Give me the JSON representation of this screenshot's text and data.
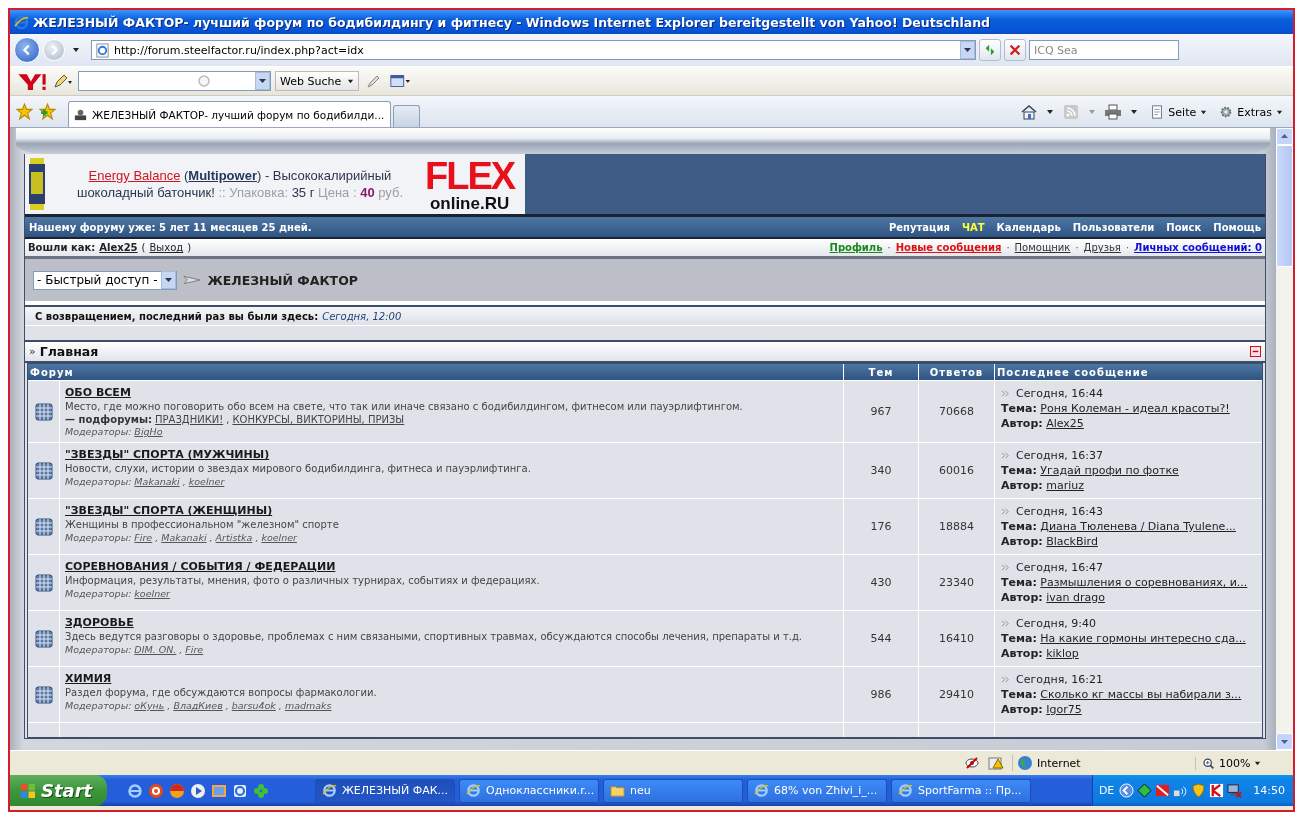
{
  "window": {
    "title": "ЖЕЛЕЗНЫЙ ФАКТОР- лучший форум по бодибилдингу и фитнесу - Windows Internet Explorer bereitgestellt von Yahoo! Deutschland"
  },
  "address_bar": {
    "url": "http://forum.steelfactor.ru/index.php?act=idx"
  },
  "search_field": {
    "placeholder": "ICQ Sea"
  },
  "yahoo_toolbar": {
    "search_button": "Web Suche"
  },
  "tabs": [
    {
      "label": "ЖЕЛЕЗНЫЙ ФАКТОР- лучший форум по бодибилди...",
      "selected": true
    }
  ],
  "command_bar": [
    "Seite",
    "Extras"
  ],
  "banner": {
    "parts": [
      {
        "kind": "product",
        "text": "Energy Balance"
      },
      {
        "kind": "text",
        "text": " ("
      },
      {
        "kind": "brand",
        "text": "Multipower"
      },
      {
        "kind": "text",
        "text": ") - Высококалирийный шоколадный батончик!"
      },
      {
        "kind": "muted",
        "text": " :: Упаковка: "
      },
      {
        "kind": "text",
        "text": "35 г"
      },
      {
        "kind": "muted",
        "text": " Цена : "
      },
      {
        "kind": "price",
        "text": "40"
      },
      {
        "kind": "muted",
        "text": " руб."
      }
    ],
    "logo_top": "FLEX",
    "logo_bottom": "online.RU"
  },
  "forum_age": "Нашему форуму уже: 5 лет 11 месяцев 25 дней.",
  "nav_links": [
    {
      "label": "Репутация",
      "highlighted": false
    },
    {
      "label": "ЧАТ",
      "highlighted": true
    },
    {
      "label": "Календарь",
      "highlighted": false
    },
    {
      "label": "Пользователи",
      "highlighted": false
    },
    {
      "label": "Поиск",
      "highlighted": false
    },
    {
      "label": "Помощь",
      "highlighted": false
    }
  ],
  "login": {
    "label": "Вошли как:",
    "user": "Alex25",
    "open": "(",
    "logout": "Выход",
    "close": ")"
  },
  "user_links": [
    {
      "label": "Профиль",
      "kind": "profile"
    },
    {
      "label": "Новые сообщения",
      "kind": "new"
    },
    {
      "label": "Помощник",
      "kind": "plain"
    },
    {
      "label": "Друзья",
      "kind": "plain"
    },
    {
      "label": "Личных сообщений: 0",
      "kind": "messages"
    }
  ],
  "separator": "·",
  "quick_access": {
    "value": "- Быстрый доступ -"
  },
  "forum_name": "ЖЕЛЕЗНЫЙ ФАКТОР",
  "welcome": {
    "text": "С возвращением, последний раз вы были здесь:",
    "time": "Сегодня, 12:00"
  },
  "category": {
    "marker": "»",
    "title": "Главная"
  },
  "table": {
    "columns": [
      "Форум",
      "Тем",
      "Ответов",
      "Последнее сообщение"
    ],
    "list_separator": ",",
    "rows": [
      {
        "name": "ОБО ВСЕМ",
        "description": "Место, где можно поговорить обо всем на свете, что так или иначе связано с бодибилдингом, фитнесом или пауэрлифтингом.",
        "subforums_label": "— подфорумы:",
        "subforums": [
          "ПРАЗДНИКИ!",
          "КОНКУРСЫ, ВИКТОРИНЫ, ПРИЗЫ"
        ],
        "moderators_label": "Модераторы:",
        "moderators": [
          "BigHo"
        ],
        "topics": "967",
        "replies": "70668",
        "last": {
          "time": "Сегодня, 16:44",
          "topic_label": "Тема:",
          "topic": "Роня Колеман - идеал красоты?!",
          "author_label": "Автор:",
          "author": "Alex25"
        }
      },
      {
        "name": "\"ЗВЕЗДЫ\" СПОРТА (МУЖЧИНЫ)",
        "description": "Новости, слухи, истории о звездах мирового бодибилдинга, фитнеса и пауэрлифтинга.",
        "moderators_label": "Модераторы:",
        "moderators": [
          "Makanaki",
          "koelner"
        ],
        "topics": "340",
        "replies": "60016",
        "last": {
          "time": "Сегодня, 16:37",
          "topic_label": "Тема:",
          "topic": "Угадай профи по фотке",
          "author_label": "Автор:",
          "author": "mariuz"
        }
      },
      {
        "name": "\"ЗВЕЗДЫ\" СПОРТА (ЖЕНЩИНЫ)",
        "description": "Женщины в профессиональном \"железном\" спорте",
        "moderators_label": "Модераторы:",
        "moderators": [
          "Fire",
          "Makanaki",
          "Artistka",
          "koelner"
        ],
        "topics": "176",
        "replies": "18884",
        "last": {
          "time": "Сегодня, 16:43",
          "topic_label": "Тема:",
          "topic": "Диана Тюленева / Diana Tyulene...",
          "author_label": "Автор:",
          "author": "BlackBird"
        }
      },
      {
        "name": "СОРЕВНОВАНИЯ / СОБЫТИЯ / ФЕДЕРАЦИИ",
        "description": "Информация, результаты, мнения, фото о различных турнирах, событиях и федерациях.",
        "moderators_label": "Модераторы:",
        "moderators": [
          "koelner"
        ],
        "topics": "430",
        "replies": "23340",
        "last": {
          "time": "Сегодня, 16:47",
          "topic_label": "Тема:",
          "topic": "Размышления о соревнованиях, и...",
          "author_label": "Автор:",
          "author": "ivan drago"
        }
      },
      {
        "name": "ЗДОРОВЬЕ",
        "description": "Здесь ведутся разговоры о здоровье, проблемах с ним связаными, спортивных травмах, обсуждаются способы лечения, препараты и т.д.",
        "moderators_label": "Модераторы:",
        "moderators": [
          "DIM. ON.",
          "Fire"
        ],
        "topics": "544",
        "replies": "16410",
        "last": {
          "time": "Сегодня, 9:40",
          "topic_label": "Тема:",
          "topic": "На какие гормоны интересно сда...",
          "author_label": "Автор:",
          "author": "kiklop"
        }
      },
      {
        "name": "ХИМИЯ",
        "description": "Раздел форума, где обсуждаются вопросы фармакологии.",
        "moderators_label": "Модераторы:",
        "moderators": [
          "oКунь",
          "ВладКиев",
          "barsu4ok",
          "madmaks"
        ],
        "topics": "986",
        "replies": "29410",
        "last": {
          "time": "Сегодня, 16:21",
          "topic_label": "Тема:",
          "topic": "Сколько кг массы вы набирали з...",
          "author_label": "Автор:",
          "author": "Igor75"
        }
      }
    ]
  },
  "status_bar": {
    "zone": "Internet",
    "zoom": "100%"
  },
  "taskbar": {
    "start": "Start",
    "windows": [
      {
        "label": "ЖЕЛЕЗНЫЙ ФАК...",
        "kind": "browser",
        "selected": true
      },
      {
        "label": "Одноклассники.r...",
        "kind": "browser",
        "selected": false
      },
      {
        "label": "neu",
        "kind": "folder",
        "selected": false
      },
      {
        "label": "68% von Zhivi_i_...",
        "kind": "browser",
        "selected": false
      },
      {
        "label": "SportFarma :: Пр...",
        "kind": "browser",
        "selected": false
      }
    ],
    "language": "DE",
    "clock": "14:50"
  }
}
